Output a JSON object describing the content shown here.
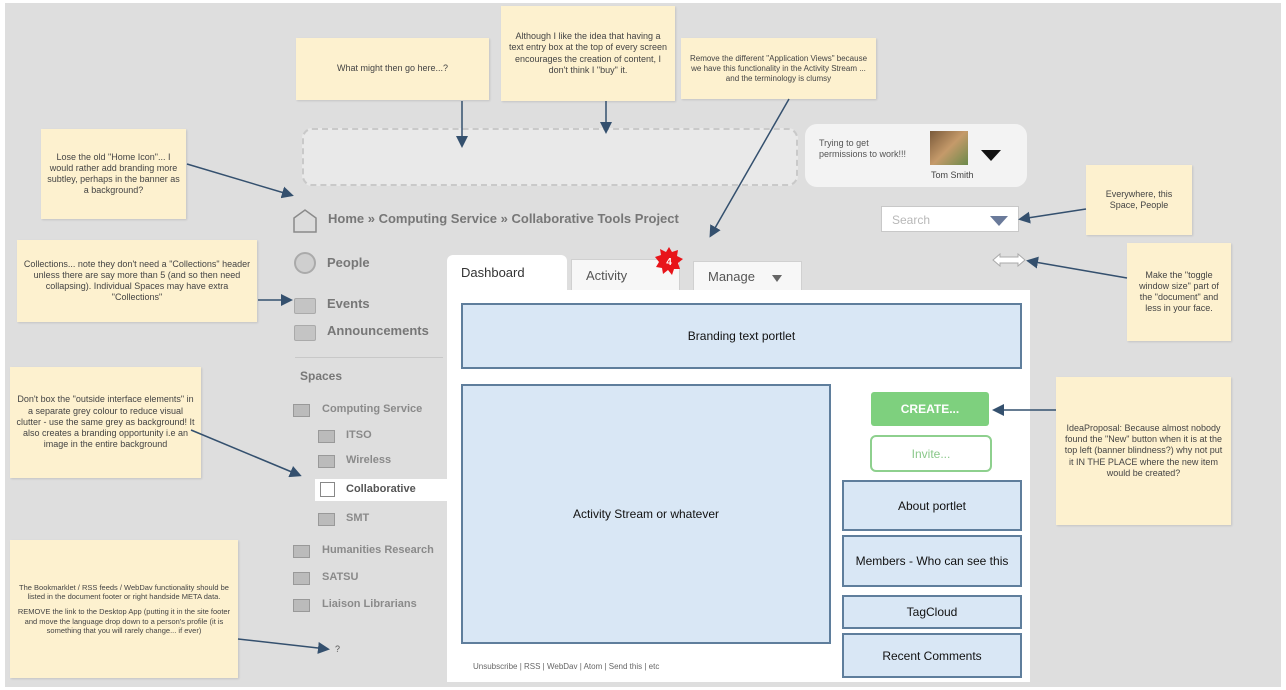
{
  "notes": {
    "top_left": "What might then go here...?",
    "top_middle": "Although I like the idea that having a text entry box at the top of every screen encourages the creation of content, I don't think I \"buy\" it.",
    "top_right": "Remove the different \"Application Views\" because we have this functionality in the Activity Stream ... and the terminology is clumsy",
    "home_icon": "Lose the old \"Home Icon\"... I would rather add branding more subtley, perhaps in the banner as a background?",
    "collections": "Collections... note they don't need a \"Collections\" header unless there are say more than 5 (and so then need collapsing). Individual Spaces may have extra \"Collections\"",
    "dont_box": "Don't box the \"outside interface elements\" in a separate grey colour to reduce visual clutter - use the same grey as background! It also creates a branding opportunity i.e an image in the entire background",
    "bookmarklet_p1": "The Bookmarklet / RSS feeds / WebDav functionality should be listed in the document footer or right handside META data.",
    "bookmarklet_p2": "REMOVE the link to the Desktop App (putting it in the site footer and move the language drop down to a person's profile (it is something that you will rarely change... if ever)",
    "search_note": "Everywhere, this Space, People",
    "toggle_note": "Make the \"toggle window size\" part of the \"document\" and less in your face.",
    "create_note": "IdeaProposal: Because almost nobody found the \"New\" button when it is at the top left (banner blindness?) why not put it IN THE PLACE where the new item would be created?"
  },
  "user": {
    "message": "Trying to get permissions to work!!!",
    "name": "Tom Smith"
  },
  "breadcrumb": "Home » Computing Service » Collaborative Tools Project",
  "search": {
    "placeholder": "Search"
  },
  "nav": {
    "people": "People",
    "events": "Events",
    "announcements": "Announcements",
    "spaces_header": "Spaces"
  },
  "spaces": {
    "computing_service": "Computing Service",
    "itso": "ITSO",
    "wireless": "Wireless",
    "collaborative": "Collaborative",
    "smt": "SMT",
    "humanities": "Humanities Research",
    "satsu": "SATSU",
    "liaison": "Liaison Librarians"
  },
  "tabs": {
    "dashboard": "Dashboard",
    "activity": "Activity",
    "manage": "Manage",
    "badge": "4"
  },
  "portlets": {
    "branding": "Branding text portlet",
    "activity_stream": "Activity Stream or whatever",
    "about": "About portlet",
    "members": "Members - Who can see this",
    "tagcloud": "TagCloud",
    "recent_comments": "Recent Comments"
  },
  "buttons": {
    "create": "CREATE...",
    "invite": "Invite..."
  },
  "footer": "Unsubscribe | RSS | WebDav | Atom | Send this | etc",
  "question_mark": "?",
  "colors": {
    "background": "#dedede",
    "note": "#fdf1cf",
    "portlet_fill": "#d9e7f5",
    "portlet_border": "#5f7e9c",
    "create_green": "#7ed07e",
    "badge_red": "#e8141a"
  }
}
